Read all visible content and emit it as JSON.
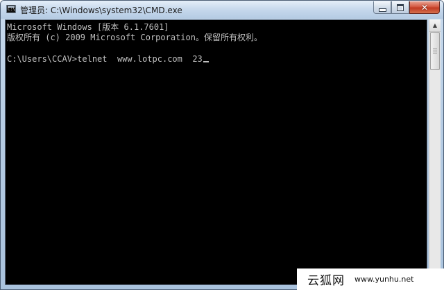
{
  "window": {
    "title": "管理员: C:\\Windows\\system32\\CMD.exe",
    "app_icon": "cmd-console-icon",
    "controls": {
      "minimize_icon": "minimize-icon",
      "maximize_icon": "maximize-icon",
      "close_glyph": "✕"
    }
  },
  "console": {
    "line1": "Microsoft Windows [版本 6.1.7601]",
    "line2": "版权所有 (c) 2009 Microsoft Corporation。保留所有权利。",
    "prompt": "C:\\Users\\CCAV>",
    "command": "telnet  www.lotpc.com  23",
    "text_color": "#c0c0c0",
    "background": "#000000"
  },
  "scrollbar": {
    "up_arrow": "▲"
  },
  "watermark": {
    "logo_text": "云狐网",
    "url": "www.yunhu.net"
  }
}
